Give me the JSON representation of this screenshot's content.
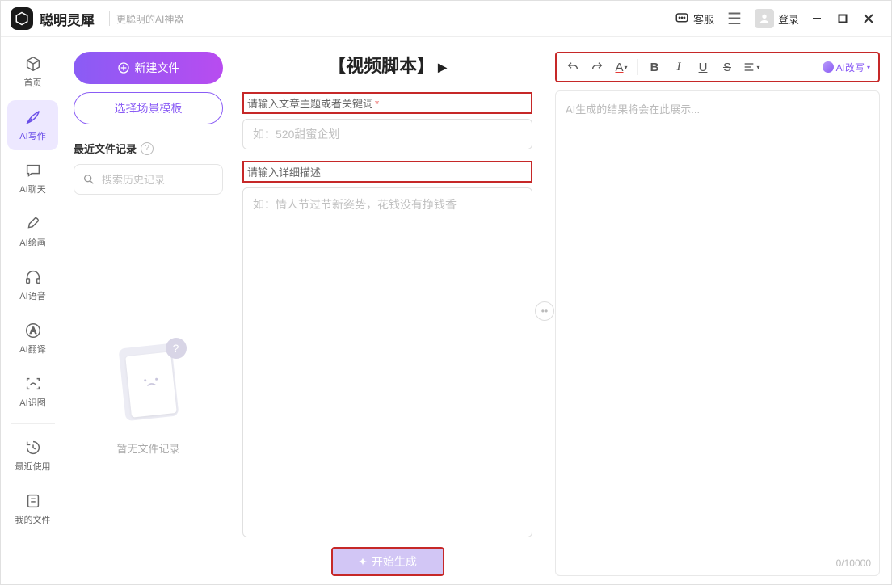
{
  "titlebar": {
    "app_name": "聪明灵犀",
    "tagline": "更聪明的AI神器",
    "support_label": "客服",
    "login_label": "登录"
  },
  "leftnav": {
    "items": [
      {
        "label": "首页",
        "active": false
      },
      {
        "label": "AI写作",
        "active": true
      },
      {
        "label": "AI聊天",
        "active": false
      },
      {
        "label": "AI绘画",
        "active": false
      },
      {
        "label": "AI语音",
        "active": false
      },
      {
        "label": "AI翻译",
        "active": false
      },
      {
        "label": "AI识图",
        "active": false
      },
      {
        "label": "最近使用",
        "active": false
      },
      {
        "label": "我的文件",
        "active": false
      }
    ]
  },
  "files": {
    "new_file_btn": "新建文件",
    "template_btn": "选择场景模板",
    "recent_header": "最近文件记录",
    "search_placeholder": "搜索历史记录",
    "empty_text": "暂无文件记录"
  },
  "center": {
    "title": "【视频脚本】",
    "topic_label": "请输入文章主题或者关键词",
    "topic_placeholder": "如：520甜蜜企划",
    "detail_label": "请输入详细描述",
    "detail_placeholder": "如：情人节过节新姿势，花钱没有挣钱香",
    "generate_btn": "开始生成"
  },
  "right": {
    "rewrite_label": "AI改写",
    "placeholder": "AI生成的结果将会在此展示...",
    "char_count": "0/10000"
  }
}
